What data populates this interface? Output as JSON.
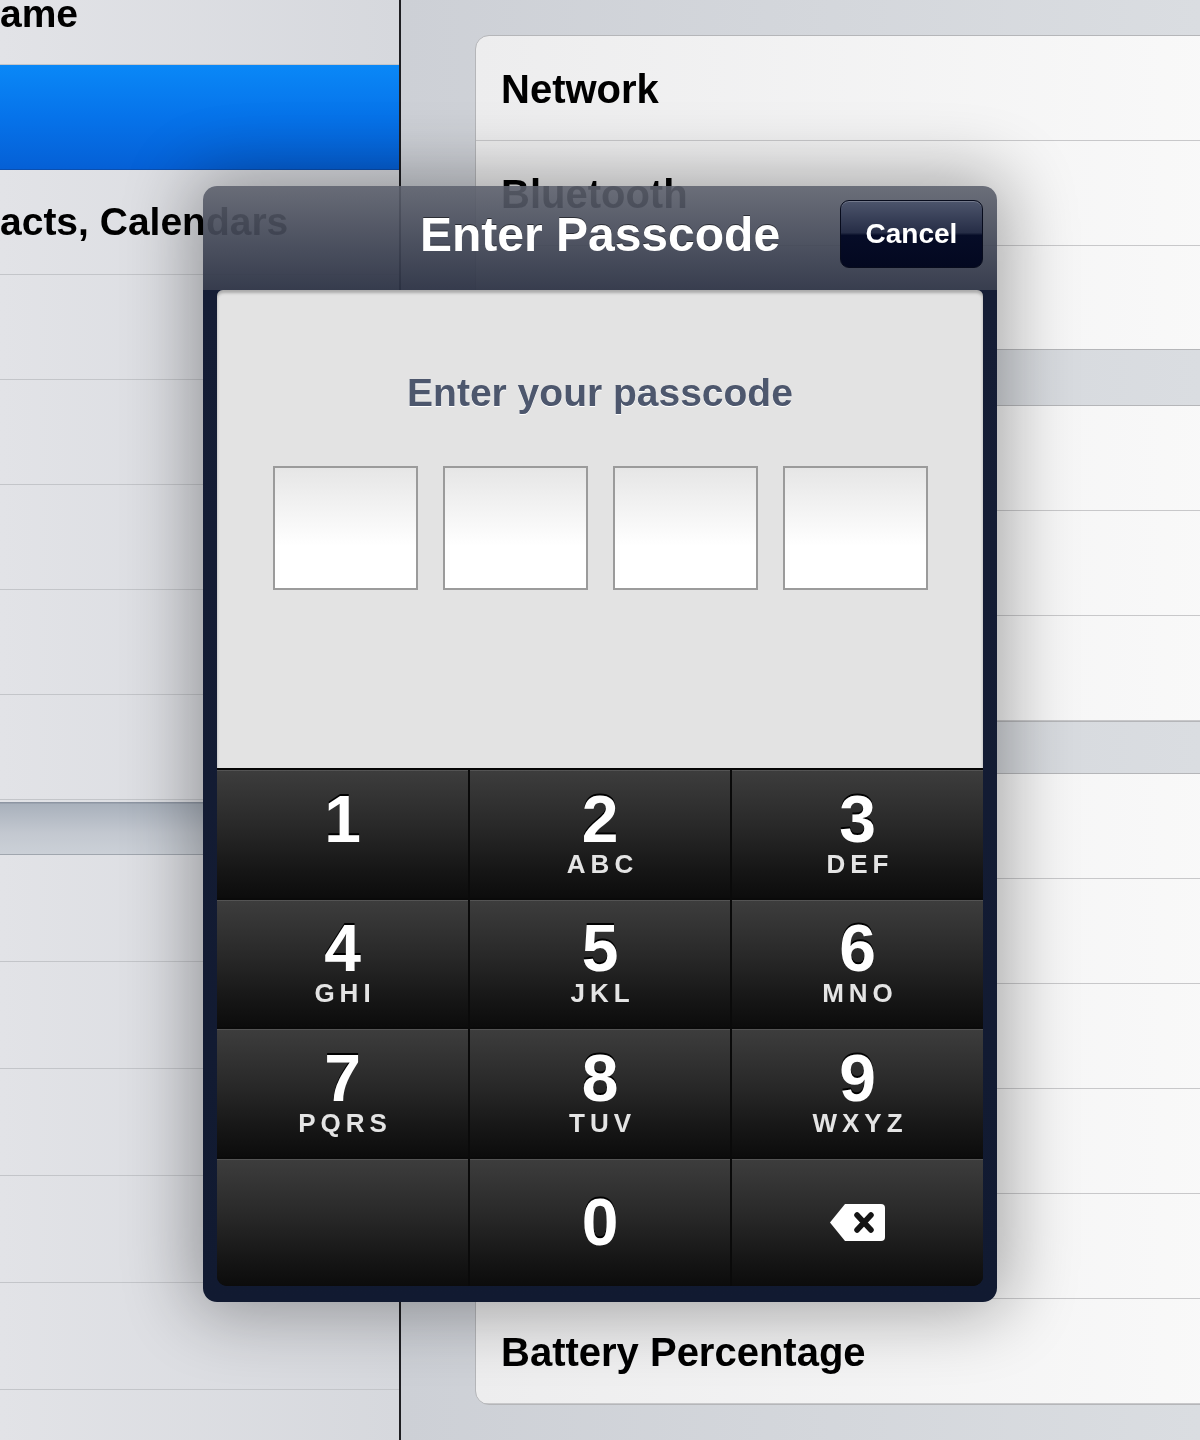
{
  "sidebar": {
    "items": [
      {
        "label": "ame",
        "selected": false
      },
      {
        "selected": true
      },
      {
        "label": "acts, Calendars",
        "selected": false
      }
    ]
  },
  "detail": {
    "groups": [
      {
        "rows": [
          {
            "label": "Network"
          },
          {
            "label": "Bluetooth"
          }
        ]
      },
      {
        "rows": [
          {
            "label": "Battery Percentage"
          }
        ]
      }
    ]
  },
  "dialog": {
    "title": "Enter Passcode",
    "cancel_button": "Cancel",
    "prompt": "Enter your passcode",
    "digit_fields": [
      {
        "filled": false
      },
      {
        "filled": false
      },
      {
        "filled": false
      },
      {
        "filled": false
      }
    ],
    "keypad": {
      "rows": [
        [
          {
            "kind": "digit",
            "digit": "1"
          },
          {
            "kind": "digit",
            "digit": "2",
            "letters": "ABC"
          },
          {
            "kind": "digit",
            "digit": "3",
            "letters": "DEF"
          }
        ],
        [
          {
            "kind": "digit",
            "digit": "4",
            "letters": "GHI"
          },
          {
            "kind": "digit",
            "digit": "5",
            "letters": "JKL"
          },
          {
            "kind": "digit",
            "digit": "6",
            "letters": "MNO"
          }
        ],
        [
          {
            "kind": "digit",
            "digit": "7",
            "letters": "PQRS"
          },
          {
            "kind": "digit",
            "digit": "8",
            "letters": "TUV"
          },
          {
            "kind": "digit",
            "digit": "9",
            "letters": "WXYZ"
          }
        ],
        [
          {
            "kind": "blank"
          },
          {
            "kind": "digit",
            "digit": "0"
          },
          {
            "kind": "delete"
          }
        ]
      ]
    }
  }
}
